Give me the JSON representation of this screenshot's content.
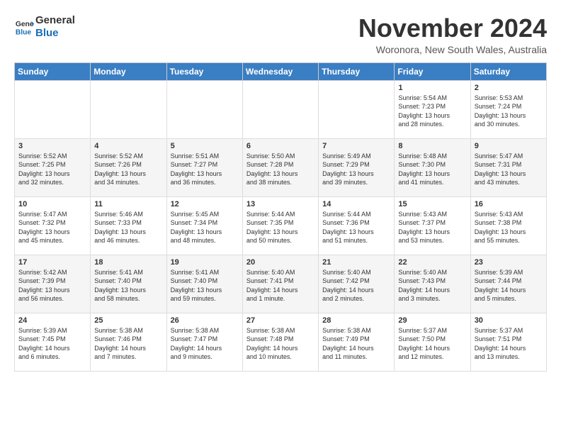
{
  "logo": {
    "line1": "General",
    "line2": "Blue"
  },
  "title": "November 2024",
  "subtitle": "Woronora, New South Wales, Australia",
  "days_of_week": [
    "Sunday",
    "Monday",
    "Tuesday",
    "Wednesday",
    "Thursday",
    "Friday",
    "Saturday"
  ],
  "weeks": [
    [
      {
        "day": "",
        "info": ""
      },
      {
        "day": "",
        "info": ""
      },
      {
        "day": "",
        "info": ""
      },
      {
        "day": "",
        "info": ""
      },
      {
        "day": "",
        "info": ""
      },
      {
        "day": "1",
        "info": "Sunrise: 5:54 AM\nSunset: 7:23 PM\nDaylight: 13 hours\nand 28 minutes."
      },
      {
        "day": "2",
        "info": "Sunrise: 5:53 AM\nSunset: 7:24 PM\nDaylight: 13 hours\nand 30 minutes."
      }
    ],
    [
      {
        "day": "3",
        "info": "Sunrise: 5:52 AM\nSunset: 7:25 PM\nDaylight: 13 hours\nand 32 minutes."
      },
      {
        "day": "4",
        "info": "Sunrise: 5:52 AM\nSunset: 7:26 PM\nDaylight: 13 hours\nand 34 minutes."
      },
      {
        "day": "5",
        "info": "Sunrise: 5:51 AM\nSunset: 7:27 PM\nDaylight: 13 hours\nand 36 minutes."
      },
      {
        "day": "6",
        "info": "Sunrise: 5:50 AM\nSunset: 7:28 PM\nDaylight: 13 hours\nand 38 minutes."
      },
      {
        "day": "7",
        "info": "Sunrise: 5:49 AM\nSunset: 7:29 PM\nDaylight: 13 hours\nand 39 minutes."
      },
      {
        "day": "8",
        "info": "Sunrise: 5:48 AM\nSunset: 7:30 PM\nDaylight: 13 hours\nand 41 minutes."
      },
      {
        "day": "9",
        "info": "Sunrise: 5:47 AM\nSunset: 7:31 PM\nDaylight: 13 hours\nand 43 minutes."
      }
    ],
    [
      {
        "day": "10",
        "info": "Sunrise: 5:47 AM\nSunset: 7:32 PM\nDaylight: 13 hours\nand 45 minutes."
      },
      {
        "day": "11",
        "info": "Sunrise: 5:46 AM\nSunset: 7:33 PM\nDaylight: 13 hours\nand 46 minutes."
      },
      {
        "day": "12",
        "info": "Sunrise: 5:45 AM\nSunset: 7:34 PM\nDaylight: 13 hours\nand 48 minutes."
      },
      {
        "day": "13",
        "info": "Sunrise: 5:44 AM\nSunset: 7:35 PM\nDaylight: 13 hours\nand 50 minutes."
      },
      {
        "day": "14",
        "info": "Sunrise: 5:44 AM\nSunset: 7:36 PM\nDaylight: 13 hours\nand 51 minutes."
      },
      {
        "day": "15",
        "info": "Sunrise: 5:43 AM\nSunset: 7:37 PM\nDaylight: 13 hours\nand 53 minutes."
      },
      {
        "day": "16",
        "info": "Sunrise: 5:43 AM\nSunset: 7:38 PM\nDaylight: 13 hours\nand 55 minutes."
      }
    ],
    [
      {
        "day": "17",
        "info": "Sunrise: 5:42 AM\nSunset: 7:39 PM\nDaylight: 13 hours\nand 56 minutes."
      },
      {
        "day": "18",
        "info": "Sunrise: 5:41 AM\nSunset: 7:40 PM\nDaylight: 13 hours\nand 58 minutes."
      },
      {
        "day": "19",
        "info": "Sunrise: 5:41 AM\nSunset: 7:40 PM\nDaylight: 13 hours\nand 59 minutes."
      },
      {
        "day": "20",
        "info": "Sunrise: 5:40 AM\nSunset: 7:41 PM\nDaylight: 14 hours\nand 1 minute."
      },
      {
        "day": "21",
        "info": "Sunrise: 5:40 AM\nSunset: 7:42 PM\nDaylight: 14 hours\nand 2 minutes."
      },
      {
        "day": "22",
        "info": "Sunrise: 5:40 AM\nSunset: 7:43 PM\nDaylight: 14 hours\nand 3 minutes."
      },
      {
        "day": "23",
        "info": "Sunrise: 5:39 AM\nSunset: 7:44 PM\nDaylight: 14 hours\nand 5 minutes."
      }
    ],
    [
      {
        "day": "24",
        "info": "Sunrise: 5:39 AM\nSunset: 7:45 PM\nDaylight: 14 hours\nand 6 minutes."
      },
      {
        "day": "25",
        "info": "Sunrise: 5:38 AM\nSunset: 7:46 PM\nDaylight: 14 hours\nand 7 minutes."
      },
      {
        "day": "26",
        "info": "Sunrise: 5:38 AM\nSunset: 7:47 PM\nDaylight: 14 hours\nand 9 minutes."
      },
      {
        "day": "27",
        "info": "Sunrise: 5:38 AM\nSunset: 7:48 PM\nDaylight: 14 hours\nand 10 minutes."
      },
      {
        "day": "28",
        "info": "Sunrise: 5:38 AM\nSunset: 7:49 PM\nDaylight: 14 hours\nand 11 minutes."
      },
      {
        "day": "29",
        "info": "Sunrise: 5:37 AM\nSunset: 7:50 PM\nDaylight: 14 hours\nand 12 minutes."
      },
      {
        "day": "30",
        "info": "Sunrise: 5:37 AM\nSunset: 7:51 PM\nDaylight: 14 hours\nand 13 minutes."
      }
    ]
  ]
}
